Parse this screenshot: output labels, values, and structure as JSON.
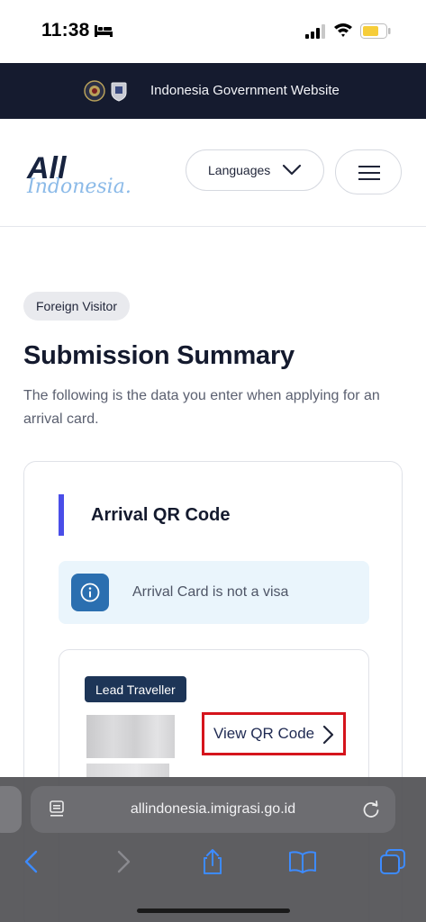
{
  "status_bar": {
    "time": "11:38"
  },
  "gov_banner": {
    "text": "Indonesia Government Website"
  },
  "header": {
    "logo_text_top": "All",
    "logo_text_bottom": "Indonesia.",
    "languages_label": "Languages"
  },
  "main": {
    "chip": "Foreign Visitor",
    "title": "Submission Summary",
    "description": "The following is the data you enter when applying for an arrival card."
  },
  "card": {
    "title": "Arrival QR Code",
    "notice": "Arrival Card is not a visa",
    "lead_badge": "Lead Traveller",
    "view_qr_label": "View QR Code"
  },
  "browser": {
    "url": "allindonesia.imigrasi.go.id"
  },
  "colors": {
    "banner_bg": "#151b2f",
    "accent": "#4a4ee8",
    "notice_bg": "#eaf5fc",
    "notice_icon_bg": "#2b6fb0",
    "badge_bg": "#1d3557",
    "highlight": "#d5141c",
    "safari_link": "#3d8bff"
  },
  "icons": [
    "bed-icon",
    "signal-icon",
    "wifi-icon",
    "battery-icon",
    "chevron-down-icon",
    "hamburger-icon",
    "info-icon",
    "chevron-right-icon",
    "page-icon",
    "reload-icon",
    "back-icon",
    "forward-icon",
    "share-icon",
    "bookmarks-icon",
    "tabs-icon"
  ]
}
